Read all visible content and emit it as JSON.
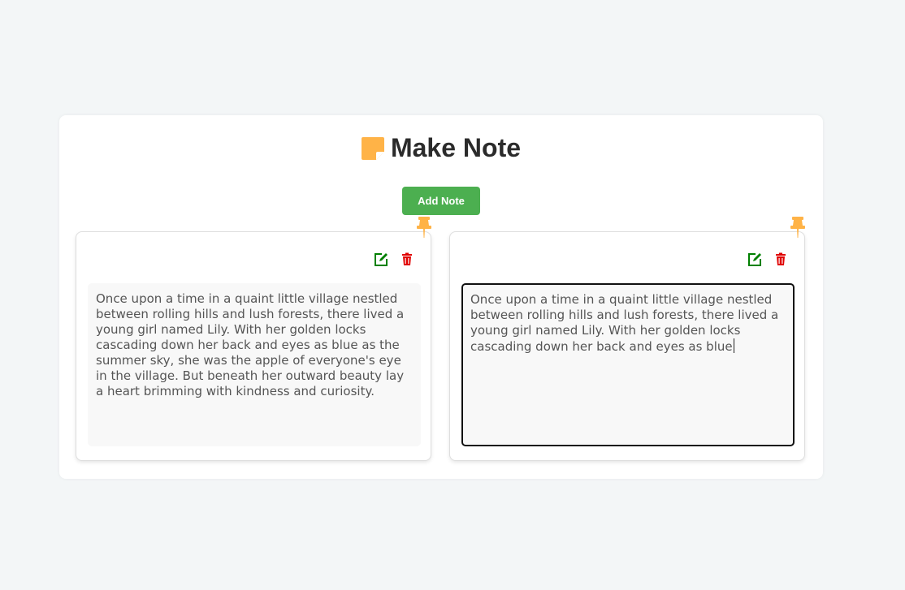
{
  "app": {
    "title": "Make Note",
    "add_button_label": "Add Note"
  },
  "colors": {
    "accent_green": "#4caf50",
    "logo_orange": "#ffb347",
    "edit_green": "#008000",
    "delete_red": "#e00000"
  },
  "icons": {
    "logo": "sticky-note-icon",
    "pin": "pushpin-icon",
    "edit": "edit-icon",
    "delete": "trash-icon"
  },
  "notes": [
    {
      "text": "Once upon a time in a quaint little village nestled between rolling hills and lush forests, there lived a young girl named Lily. With her golden locks cascading down her back and eyes as blue as the summer sky, she was the apple of everyone's eye in the village. But beneath her outward beauty lay a heart brimming with kindness and curiosity.",
      "focused": false
    },
    {
      "text": "Once upon a time in a quaint little village nestled between rolling hills and lush forests, there lived a young girl named Lily. With her golden locks cascading down her back and eyes as blue",
      "focused": true
    }
  ]
}
